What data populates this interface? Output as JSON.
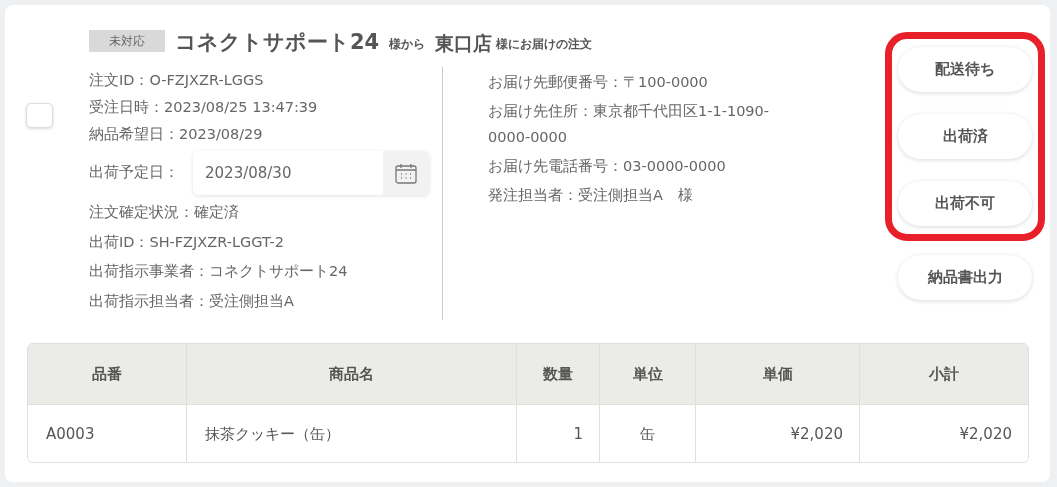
{
  "order": {
    "checked": false,
    "status_badge": "未対応",
    "sender": "コネクトサポート24",
    "sender_suffix": "様から",
    "recipient": "東口店",
    "recipient_suffix": "様にお届けの注文",
    "left_info": [
      "注文ID：O-FZJXZR-LGGS",
      "受注日時：2023/08/25 13:47:39",
      "納品希望日：2023/08/29"
    ],
    "ship_date": {
      "label": "出荷予定日：",
      "value": "2023/08/30"
    },
    "left_info_after": [
      "注文確定状況：確定済",
      "出荷ID：SH-FZJXZR-LGGT-2",
      "出荷指示事業者：コネクトサポート24",
      "出荷指示担当者：受注側担当A"
    ],
    "right_info": [
      "お届け先郵便番号：〒100-0000",
      "お届け先住所：東京都千代田区1-1-1090-0000-0000",
      "お届け先電話番号：03-0000-0000",
      "発注担当者：受注側担当A　様"
    ],
    "highlighted_actions": [
      "配送待ち",
      "出荷済",
      "出荷不可"
    ],
    "actions": [
      "納品書出力"
    ]
  },
  "table": {
    "columns": [
      "品番",
      "商品名",
      "数量",
      "単位",
      "単価",
      "小計"
    ],
    "rows": [
      [
        "A0003",
        "抹茶クッキー（缶）",
        "1",
        "缶",
        "¥2,020",
        "¥2,020"
      ]
    ]
  }
}
